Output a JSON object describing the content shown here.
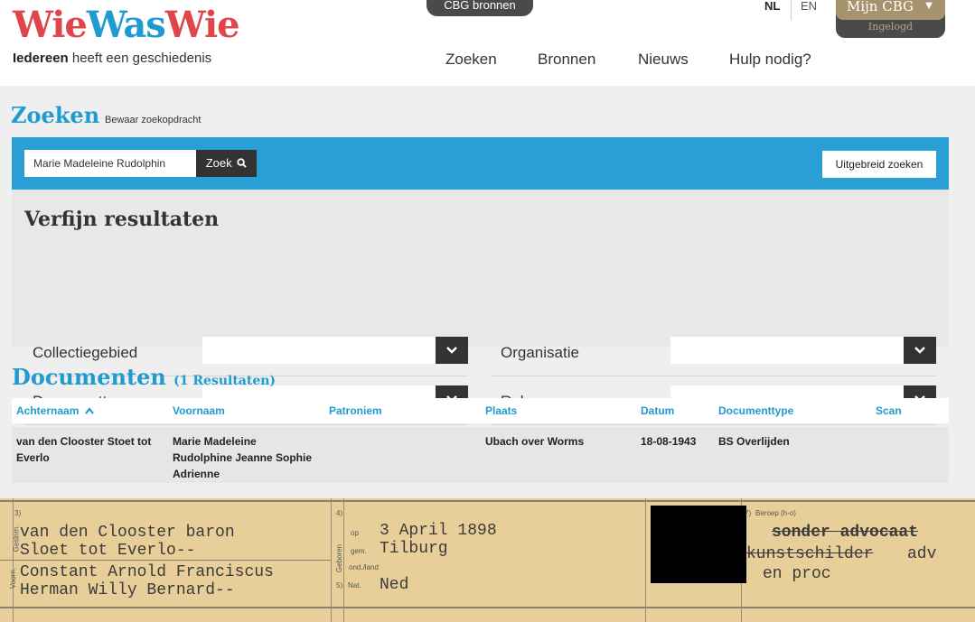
{
  "header": {
    "logo_part1": "Wie",
    "logo_part2": "Was",
    "logo_part3": "Wie",
    "tagline_bold": "Iedereen",
    "tagline_rest": "heeft een geschiedenis",
    "cbg_bronnen": "CBG bronnen",
    "lang_nl": "NL",
    "lang_en": "EN",
    "account_label": "Mijn CBG",
    "account_status": "Ingelogd",
    "nav": [
      "Zoeken",
      "Bronnen",
      "Nieuws",
      "Hulp nodig?"
    ]
  },
  "search": {
    "title": "Zoeken",
    "save_link": "Bewaar zoekopdracht",
    "query": "Marie Madeleine Rudolphin",
    "button": "Zoek",
    "advanced": "Uitgebreid zoeken"
  },
  "refine": {
    "title": "Verfijn resultaten",
    "filters": [
      "Collectiegebied",
      "Organisatie",
      "Documenttype",
      "Rol"
    ]
  },
  "documents": {
    "title": "Documenten",
    "count": "(1 Resultaten)",
    "columns": [
      "Achternaam",
      "Voornaam",
      "Patroniem",
      "Plaats",
      "Datum",
      "Documenttype",
      "Scan"
    ],
    "row": {
      "achternaam": [
        "van den Clooster Stoet tot",
        "Everlo"
      ],
      "voornaam": [
        "Marie Madeleine",
        "Rudolphine Jeanne Sophie",
        "Adrienne"
      ],
      "patroniem": "",
      "plaats": "Ubach over Worms",
      "datum": "18-08-1943",
      "documenttype": "BS Overlijden"
    }
  },
  "scan": {
    "surname_line1": "van den Clooster baron",
    "surname_line2": "Sloet tot Everlo--",
    "given_line1": "Constant Arnold Franciscus",
    "given_line2": "Herman Willy Bernard--",
    "op_label": "op",
    "birth_date": "3 April 1898",
    "gem_label": "gem.",
    "birth_place": "Tilburg",
    "ond_label": "ond./land",
    "nat_label": "Nat.",
    "nationality": "Ned",
    "beroep_label": "Beroep (h-o)",
    "occ_line1": "sonder advocaat",
    "occ_line2a": "kunstschilder",
    "occ_line2b": "adv",
    "occ_line3": "en proc",
    "field3": "3)",
    "field4": "4)",
    "field5": "5)",
    "field7": "7)",
    "side_geslnm": "Geslnm.",
    "side_voorn": "Voorn.",
    "side_geboren": "Geboren"
  }
}
